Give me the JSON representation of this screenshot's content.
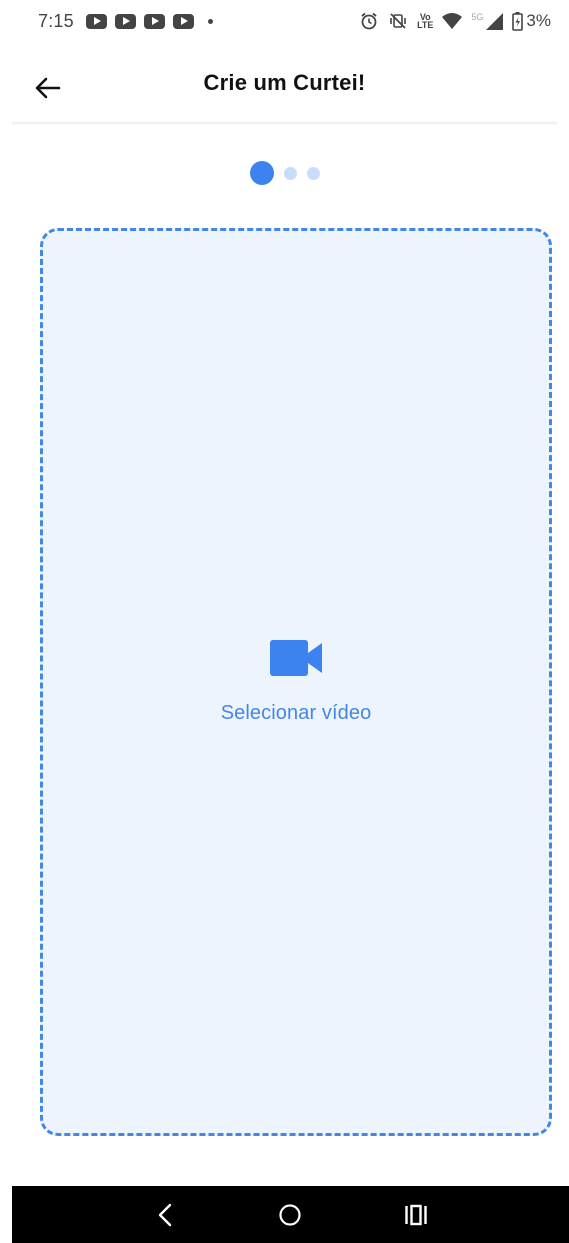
{
  "status_bar": {
    "time": "7:15",
    "notification_icons": [
      "youtube-icon",
      "youtube-icon",
      "youtube-icon",
      "youtube-icon",
      "more-dot-icon"
    ],
    "volte_top": "Vo",
    "volte_bottom": "LTE",
    "network_label": "5G",
    "battery_percent": "3%"
  },
  "header": {
    "title": "Crie um Curtei!",
    "back_icon": "arrow-left-icon"
  },
  "stepper": {
    "total_steps": 3,
    "current_step": 1
  },
  "upload": {
    "icon": "video-camera-icon",
    "label": "Selecionar vídeo"
  },
  "nav_bar": {
    "buttons": [
      "back-nav-icon",
      "home-nav-icon",
      "recents-nav-icon"
    ]
  },
  "colors": {
    "accent": "#3d83f0",
    "accent_light": "#c8dcfb",
    "upload_border": "#4387e6",
    "upload_background": "#edf4fe",
    "nav_background": "#000000"
  }
}
